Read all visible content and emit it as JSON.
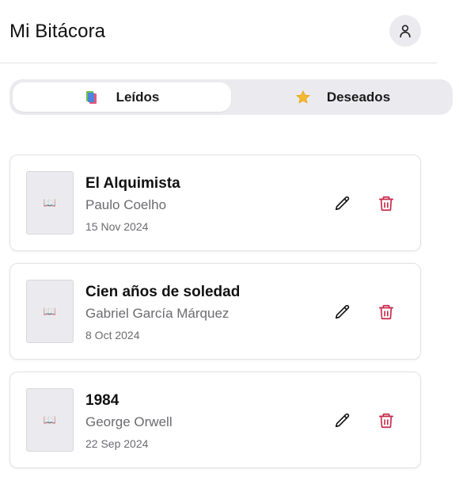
{
  "header": {
    "title": "Mi Bitácora",
    "profile_icon": "user-icon"
  },
  "tabs": [
    {
      "label": "Leídos",
      "icon": "books-icon",
      "active": true
    },
    {
      "label": "Deseados",
      "icon": "star-icon",
      "active": false
    }
  ],
  "books": [
    {
      "title": "El Alquimista",
      "author": "Paulo Coelho",
      "date": "15 Nov 2024",
      "cover_icon": "📖"
    },
    {
      "title": "Cien años de soledad",
      "author": "Gabriel García Márquez",
      "date": "8 Oct 2024",
      "cover_icon": "📖"
    },
    {
      "title": "1984",
      "author": "George Orwell",
      "date": "22 Sep 2024",
      "cover_icon": "📖"
    }
  ],
  "colors": {
    "delete": "#c8294a",
    "muted_text": "#6b6b70",
    "segment_bg": "#ebebef"
  }
}
